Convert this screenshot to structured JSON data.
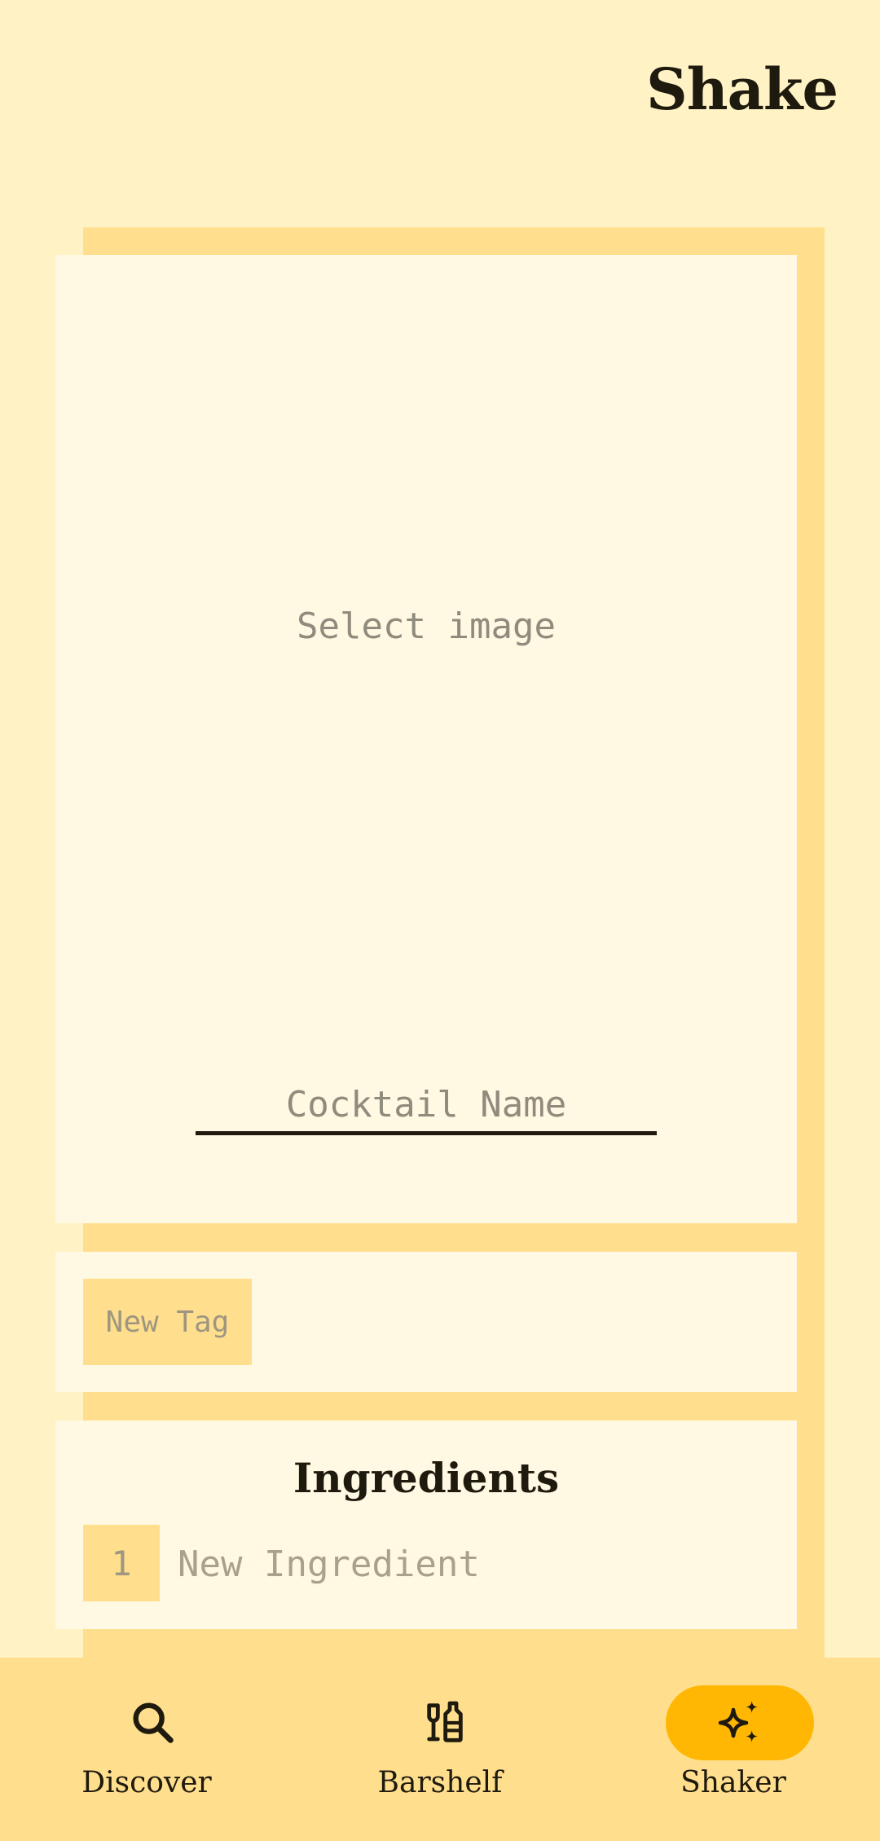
{
  "app": {
    "title": "Shake"
  },
  "editor": {
    "select_image_label": "Select image",
    "name_placeholder": "Cocktail Name",
    "new_tag_label": "New Tag",
    "ingredients": {
      "title": "Ingredients",
      "rows": [
        {
          "number": "1",
          "placeholder": "New Ingredient"
        }
      ]
    }
  },
  "nav": {
    "items": [
      {
        "label": "Discover",
        "icon": "search-icon",
        "active": false
      },
      {
        "label": "Barshelf",
        "icon": "bottle-glass-icon",
        "active": false
      },
      {
        "label": "Shaker",
        "icon": "sparkles-icon",
        "active": true
      }
    ]
  },
  "colors": {
    "background": "#FFF3C6",
    "panel": "#FFDF8E",
    "card": "#FFF8E2",
    "accent": "#FFB703",
    "text": "#1F1A0E"
  }
}
